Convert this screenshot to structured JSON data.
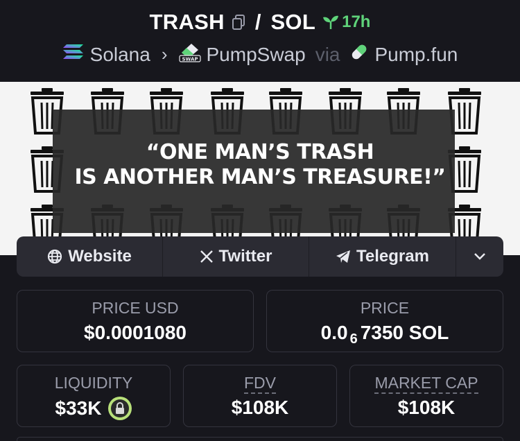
{
  "header": {
    "token_symbol": "TRASH",
    "separator": "/",
    "quote_symbol": "SOL",
    "age": "17h",
    "chain": "Solana",
    "dex": "PumpSwap",
    "via_label": "via",
    "launchpad": "Pump.fun",
    "dex_badge": "SWAP"
  },
  "banner": {
    "quote_line1": "“ONE MAN’S TRASH",
    "quote_line2": "IS ANOTHER MAN’S TREASURE!”"
  },
  "links": {
    "website": "Website",
    "twitter": "Twitter",
    "telegram": "Telegram"
  },
  "stats": {
    "price_usd_label": "PRICE USD",
    "price_usd_value": "$0.0001080",
    "price_label": "PRICE",
    "price_value_prefix": "0.0",
    "price_value_zeros": "6",
    "price_value_suffix": "7350 SOL",
    "liquidity_label": "LIQUIDITY",
    "liquidity_value": "$33K",
    "fdv_label": "FDV",
    "fdv_value": "$108K",
    "mcap_label": "MARKET CAP",
    "mcap_value": "$108K"
  },
  "colors": {
    "background": "#17171d",
    "panel": "#2b2b33",
    "accent_green": "#5fd37a",
    "lock_green": "#b8e07a"
  }
}
